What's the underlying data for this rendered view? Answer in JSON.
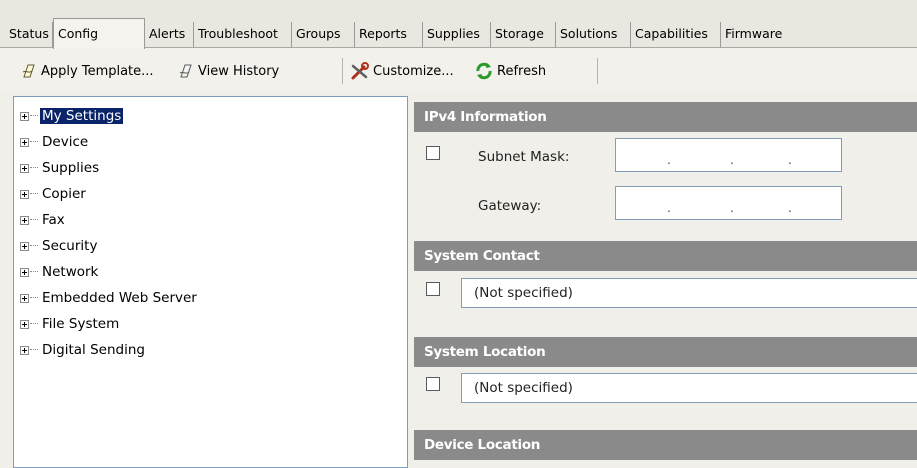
{
  "tabs": [
    {
      "label": "Status",
      "active": false
    },
    {
      "label": "Config",
      "active": true
    },
    {
      "label": "Alerts",
      "active": false
    },
    {
      "label": "Troubleshoot",
      "active": false
    },
    {
      "label": "Groups",
      "active": false
    },
    {
      "label": "Reports",
      "active": false
    },
    {
      "label": "Supplies",
      "active": false
    },
    {
      "label": "Storage",
      "active": false
    },
    {
      "label": "Solutions",
      "active": false
    },
    {
      "label": "Capabilities",
      "active": false
    },
    {
      "label": "Firmware",
      "active": false
    }
  ],
  "toolbar": {
    "apply_template": "Apply Template...",
    "view_history": "View History",
    "customize": "Customize...",
    "refresh": "Refresh",
    "icons": {
      "apply_template": "template-icon",
      "view_history": "history-icon",
      "customize": "tools-icon",
      "refresh": "refresh-icon"
    }
  },
  "tree": {
    "selected": "My Settings",
    "items": [
      "My Settings",
      "Device",
      "Supplies",
      "Copier",
      "Fax",
      "Security",
      "Network",
      "Embedded Web Server",
      "File System",
      "Digital Sending"
    ]
  },
  "panel": {
    "ipv4": {
      "title": "IPv4 Information",
      "subnet_label": "Subnet Mask:",
      "gateway_label": "Gateway:",
      "ip_separator": "."
    },
    "system_contact": {
      "title": "System Contact",
      "value": "(Not specified)"
    },
    "system_location": {
      "title": "System Location",
      "value": "(Not specified)"
    },
    "device_location": {
      "title": "Device Location"
    }
  },
  "colors": {
    "section_header": "#8a8a8a",
    "selection": "#0a246a"
  }
}
